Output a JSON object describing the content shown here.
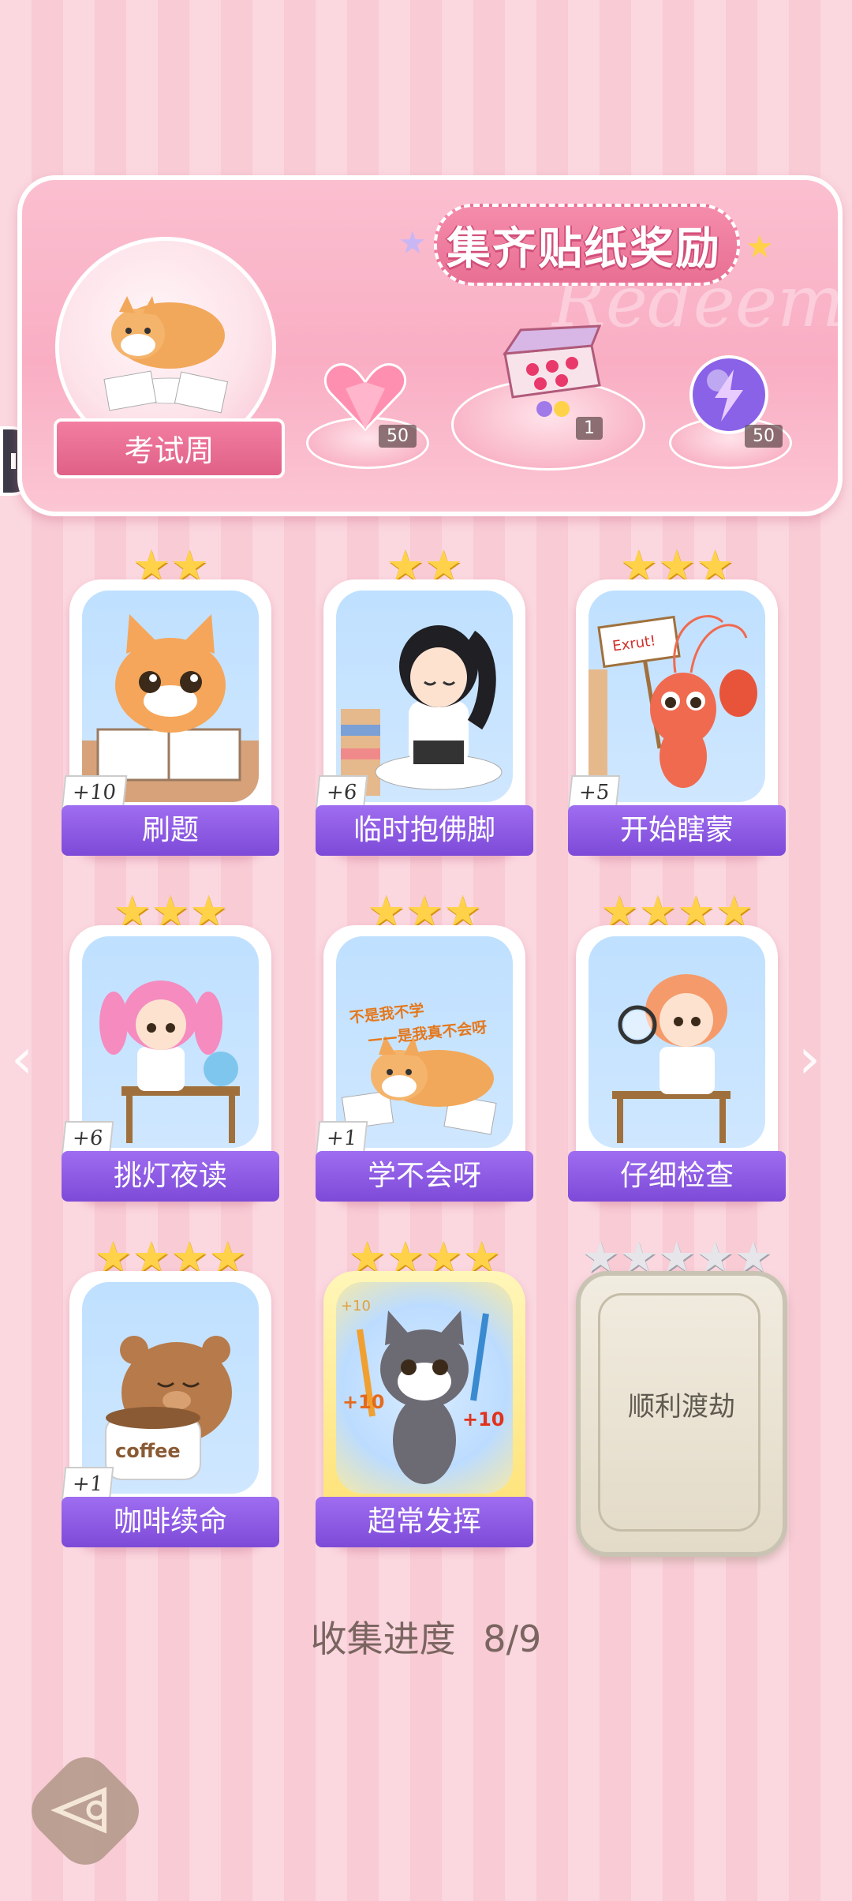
{
  "banner": {
    "title": "集齐贴纸奖励",
    "theme_label": "考试周",
    "watermark": "Redeem",
    "rewards": [
      {
        "icon": "heart-gem-icon",
        "count": "50"
      },
      {
        "icon": "gift-box-icon",
        "count": "1"
      },
      {
        "icon": "lightning-orb-icon",
        "count": "50"
      }
    ]
  },
  "cards": [
    {
      "label": "刷题",
      "bonus": "+10",
      "stars": 2,
      "icon": "cat-reading-icon"
    },
    {
      "label": "临时抱佛脚",
      "bonus": "+6",
      "stars": 2,
      "icon": "girl-praying-icon"
    },
    {
      "label": "开始瞎蒙",
      "bonus": "+5",
      "stars": 3,
      "icon": "shrimp-sign-icon",
      "sign_text": "Exrut!"
    },
    {
      "label": "挑灯夜读",
      "bonus": "+6",
      "stars": 3,
      "icon": "girl-desk-icon"
    },
    {
      "label": "学不会呀",
      "bonus": "+1",
      "stars": 3,
      "icon": "shiba-lying-icon",
      "caption_lines": [
        "不是我不学",
        "——是我真不会呀"
      ]
    },
    {
      "label": "仔细检查",
      "bonus": "",
      "stars": 4,
      "icon": "girl-magnifier-icon"
    },
    {
      "label": "咖啡续命",
      "bonus": "+1",
      "stars": 4,
      "icon": "bear-coffee-icon",
      "cup_text": "coffee"
    },
    {
      "label": "超常发挥",
      "bonus": "",
      "stars": 4,
      "icon": "cat-pencils-icon",
      "marks": [
        "+10",
        "+10",
        "+10"
      ]
    },
    {
      "label": "顺利渡劫",
      "bonus": "",
      "stars": 5,
      "locked": true,
      "icon": "locked-card-icon"
    }
  ],
  "progress": {
    "label": "收集进度",
    "value": "8/9"
  },
  "colors": {
    "ribbon": "#8b58e3",
    "star_gold": "#ffd24a",
    "banner": "#f9aec4",
    "background": "#fbd7df"
  }
}
